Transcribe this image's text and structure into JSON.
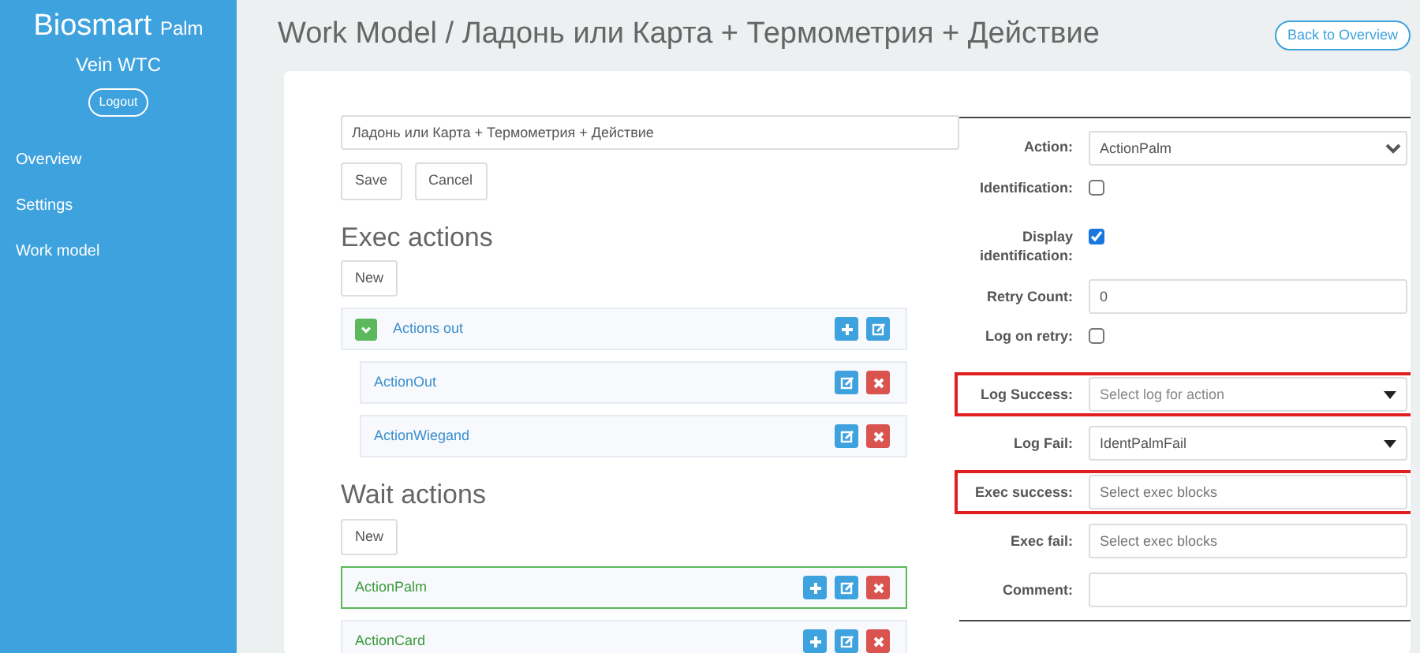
{
  "sidebar": {
    "brand": "Biosmart",
    "brand_suffix": "Palm",
    "subtitle": "Vein WTC",
    "logout": "Logout",
    "items": [
      {
        "label": "Overview"
      },
      {
        "label": "Settings"
      },
      {
        "label": "Work model"
      }
    ]
  },
  "header": {
    "title": "Work Model / Ладонь или Карта + Термометрия + Действие",
    "back_button": "Back to Overview"
  },
  "name_field": {
    "value": "Ладонь или Карта + Термометрия + Действие"
  },
  "buttons": [
    "Save",
    "Cancel"
  ],
  "sections": [
    {
      "kind": "exec",
      "title": "Exec actions",
      "new_button": "New",
      "items": [
        {
          "label": "Actions out",
          "expanded": true,
          "selected": false,
          "actions": [
            {
              "kind": "add"
            },
            {
              "kind": "edit"
            }
          ],
          "children": [
            {
              "label": "ActionOut",
              "selected": false,
              "actions": [
                {
                  "kind": "edit"
                },
                {
                  "kind": "delete"
                }
              ]
            },
            {
              "label": "ActionWiegand",
              "selected": false,
              "actions": [
                {
                  "kind": "edit"
                },
                {
                  "kind": "delete"
                }
              ]
            }
          ]
        }
      ]
    },
    {
      "kind": "wait",
      "title": "Wait actions",
      "new_button": "New",
      "items": [
        {
          "label": "ActionPalm",
          "selected": true,
          "actions": [
            {
              "kind": "add"
            },
            {
              "kind": "edit"
            },
            {
              "kind": "delete"
            }
          ]
        },
        {
          "label": "ActionCard",
          "selected": false,
          "actions": [
            {
              "kind": "add"
            },
            {
              "kind": "edit"
            },
            {
              "kind": "delete"
            }
          ]
        }
      ]
    }
  ],
  "form": [
    {
      "kind": "select",
      "label": "Action:",
      "value": "ActionPalm"
    },
    {
      "kind": "checkbox",
      "label": "Identification:",
      "checked": false
    },
    {
      "kind": "checkbox",
      "label": "Display identification:",
      "checked": true
    },
    {
      "kind": "input",
      "label": "Retry Count:",
      "value": "0"
    },
    {
      "kind": "checkbox",
      "label": "Log on retry:",
      "checked": false
    },
    {
      "kind": "dropdown",
      "label": "Log Success:",
      "placeholder": "Select log for action",
      "highlighted": true
    },
    {
      "kind": "dropdown",
      "label": "Log Fail:",
      "value": "IdentPalmFail"
    },
    {
      "kind": "input",
      "label": "Exec success:",
      "placeholder": "Select exec blocks",
      "highlighted": true
    },
    {
      "kind": "input",
      "label": "Exec fail:",
      "placeholder": "Select exec blocks"
    },
    {
      "kind": "input",
      "label": "Comment:"
    }
  ]
}
